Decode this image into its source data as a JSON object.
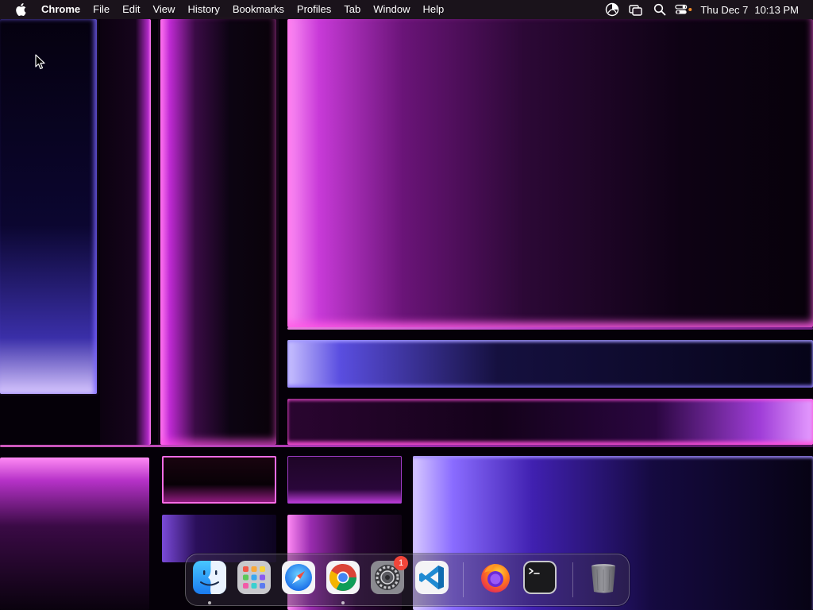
{
  "menubar": {
    "apple_icon": "apple-icon",
    "app_name": "Chrome",
    "menus": [
      "File",
      "Edit",
      "View",
      "History",
      "Bookmarks",
      "Profiles",
      "Tab",
      "Window",
      "Help"
    ],
    "status_icons": [
      "screen-time-icon",
      "screen-mirroring-icon",
      "search-icon",
      "control-center-icon"
    ],
    "clock": {
      "date": "Thu Dec 7",
      "time": "10:13 PM"
    }
  },
  "dock": {
    "apps": [
      {
        "name": "Finder",
        "icon": "finder-icon",
        "running": true
      },
      {
        "name": "Launchpad",
        "icon": "launchpad-icon",
        "running": false
      },
      {
        "name": "Safari",
        "icon": "safari-icon",
        "running": false
      },
      {
        "name": "Google Chrome",
        "icon": "chrome-icon",
        "running": true
      },
      {
        "name": "System Settings",
        "icon": "system-settings-icon",
        "running": false,
        "badge": "1"
      },
      {
        "name": "Visual Studio Code",
        "icon": "vscode-icon",
        "running": false
      },
      {
        "name": "Firefox",
        "icon": "firefox-icon",
        "running": false
      },
      {
        "name": "Terminal",
        "icon": "terminal-icon",
        "running": false
      },
      {
        "name": "Trash",
        "icon": "trash-icon",
        "running": false
      }
    ]
  },
  "colors": {
    "menubar_bg": "#1e161e",
    "accent_pink": "#ff70e8",
    "accent_blue": "#6a5cff",
    "badge": "#f0453a"
  }
}
